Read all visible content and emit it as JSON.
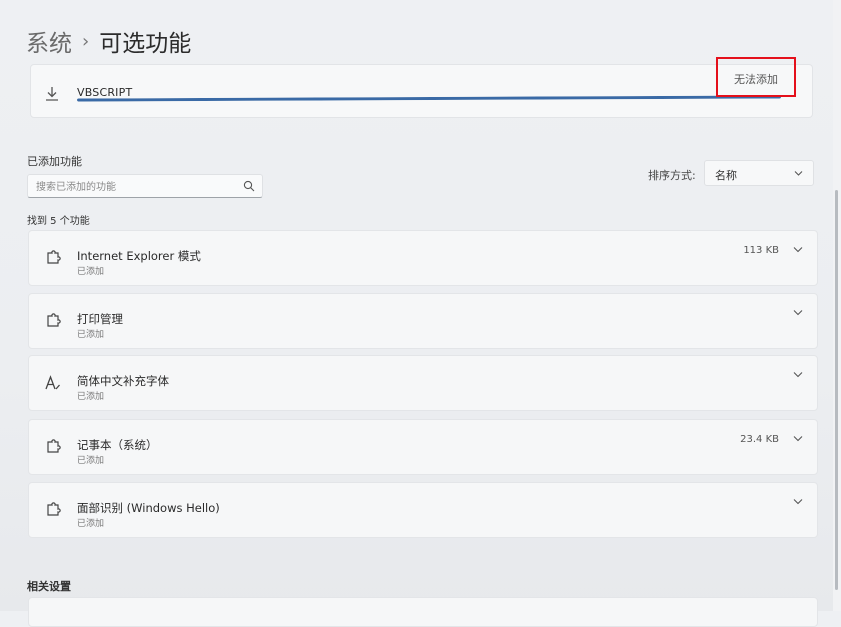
{
  "breadcrumb": {
    "parent": "系统",
    "separator": "›",
    "current": "可选功能"
  },
  "installing": {
    "name": "VBSCRIPT",
    "status": "无法添加",
    "progress_percent": 100
  },
  "added_section": {
    "title": "已添加功能",
    "search_placeholder": "搜索已添加的功能",
    "sort_label": "排序方式:",
    "sort_value": "名称",
    "found_text": "找到 5 个功能"
  },
  "features": [
    {
      "name": "Internet Explorer 模式",
      "status": "已添加",
      "size": "113 KB",
      "icon": "puzzle-icon"
    },
    {
      "name": "打印管理",
      "status": "已添加",
      "size": "",
      "icon": "puzzle-icon"
    },
    {
      "name": "简体中文补充字体",
      "status": "已添加",
      "size": "",
      "icon": "font-icon"
    },
    {
      "name": "记事本（系统）",
      "status": "已添加",
      "size": "23.4 KB",
      "icon": "puzzle-icon"
    },
    {
      "name": "面部识别 (Windows Hello)",
      "status": "已添加",
      "size": "",
      "icon": "puzzle-icon"
    }
  ],
  "related": {
    "title": "相关设置"
  },
  "colors": {
    "accent": "#3a6aa6",
    "highlight": "#e4101b"
  }
}
